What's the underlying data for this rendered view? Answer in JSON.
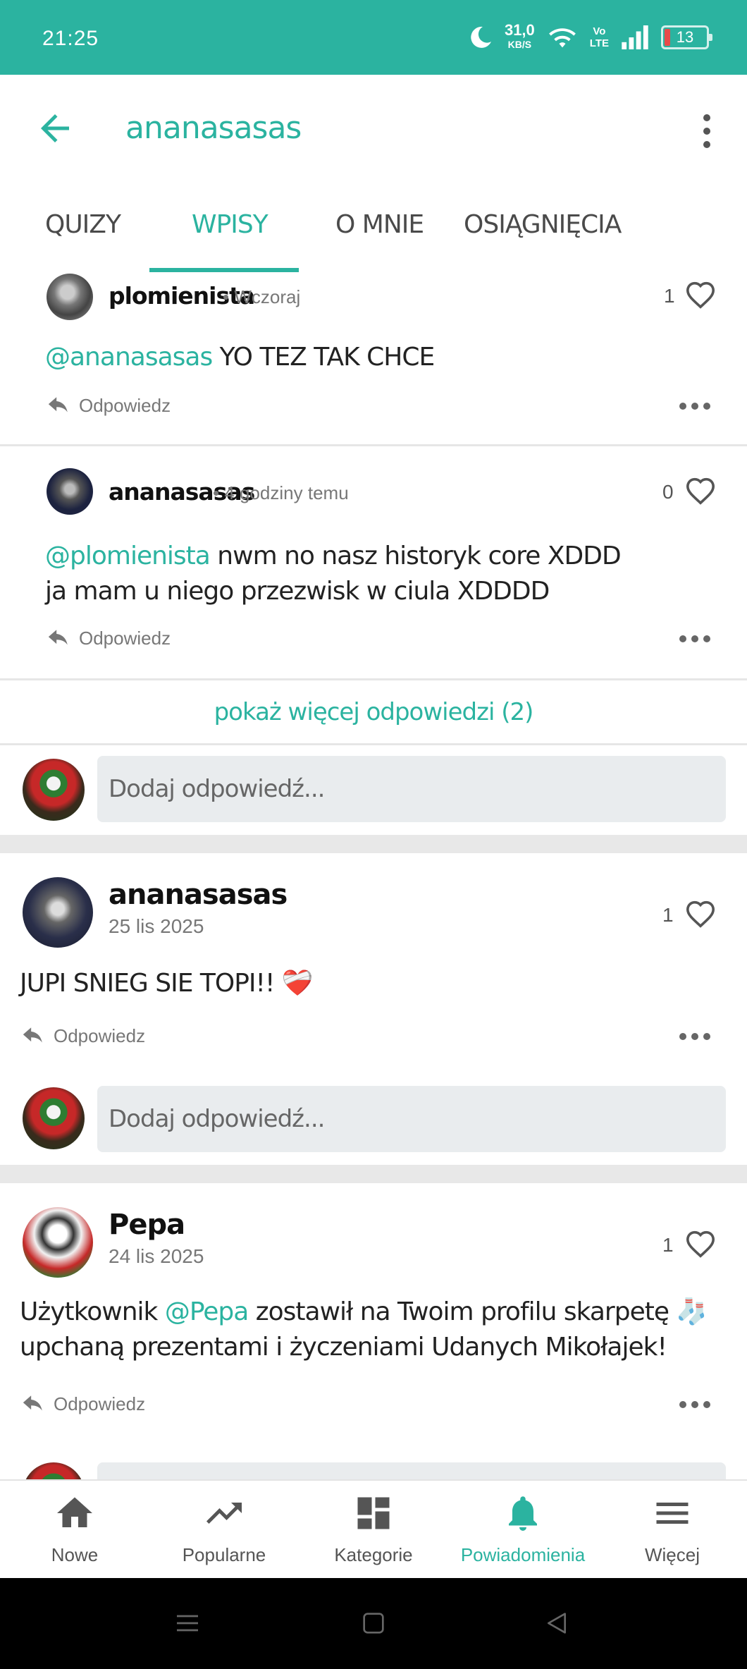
{
  "status_bar": {
    "time": "21:25",
    "network_speed_value": "31,0",
    "network_speed_unit": "KB/S",
    "volte_label_top": "Vo",
    "volte_label_bottom": "LTE",
    "battery_level": "13"
  },
  "app_bar": {
    "title": "ananasasas"
  },
  "tabs": [
    {
      "label": "QUIZY"
    },
    {
      "label": "WPISY"
    },
    {
      "label": "O MNIE"
    },
    {
      "label": "OSIĄGNIĘCIA"
    }
  ],
  "active_tab": "WPISY",
  "thread": {
    "replies": [
      {
        "author": "plomienista",
        "time": "• Wczoraj",
        "likes": "1",
        "mention": "@ananasasas",
        "text": " YO TEZ TAK CHCE",
        "reply_label": "Odpowiedz"
      },
      {
        "author": "ananasasas",
        "time": "• 4 godziny temu",
        "likes": "0",
        "mention": "@plomienista",
        "text": " nwm no nasz historyk core XDDD",
        "text_line2": "ja mam u niego przezwisk w ciula XDDDD",
        "reply_label": "Odpowiedz"
      }
    ],
    "show_more": "pokaż więcej odpowiedzi (2)",
    "compose_placeholder": "Dodaj odpowiedź..."
  },
  "posts": [
    {
      "author": "ananasasas",
      "date": "25 lis 2025",
      "likes": "1",
      "text": "JUPI SNIEG SIE TOPI!! ❤️‍🩹",
      "reply_label": "Odpowiedz",
      "compose_placeholder": "Dodaj odpowiedź..."
    },
    {
      "author": "Pepa",
      "date": "24 lis 2025",
      "likes": "1",
      "text_before": "Użytkownik ",
      "mention": "@Pepa",
      "text_after": " zostawił na Twoim profilu skarpetę 🧦",
      "text_line2": "upchaną prezentami i życzeniami Udanych Mikołajek!",
      "reply_label": "Odpowiedz"
    }
  ],
  "bottom_nav": [
    {
      "label": "Nowe",
      "icon": "home-icon"
    },
    {
      "label": "Popularne",
      "icon": "trending-icon"
    },
    {
      "label": "Kategorie",
      "icon": "dashboard-icon"
    },
    {
      "label": "Powiadomienia",
      "icon": "bell-icon"
    },
    {
      "label": "Więcej",
      "icon": "menu-icon"
    }
  ],
  "colors": {
    "accent": "#2bb3a0",
    "status_bar": "#2bb3a0",
    "text": "#222222",
    "muted": "#777777"
  }
}
